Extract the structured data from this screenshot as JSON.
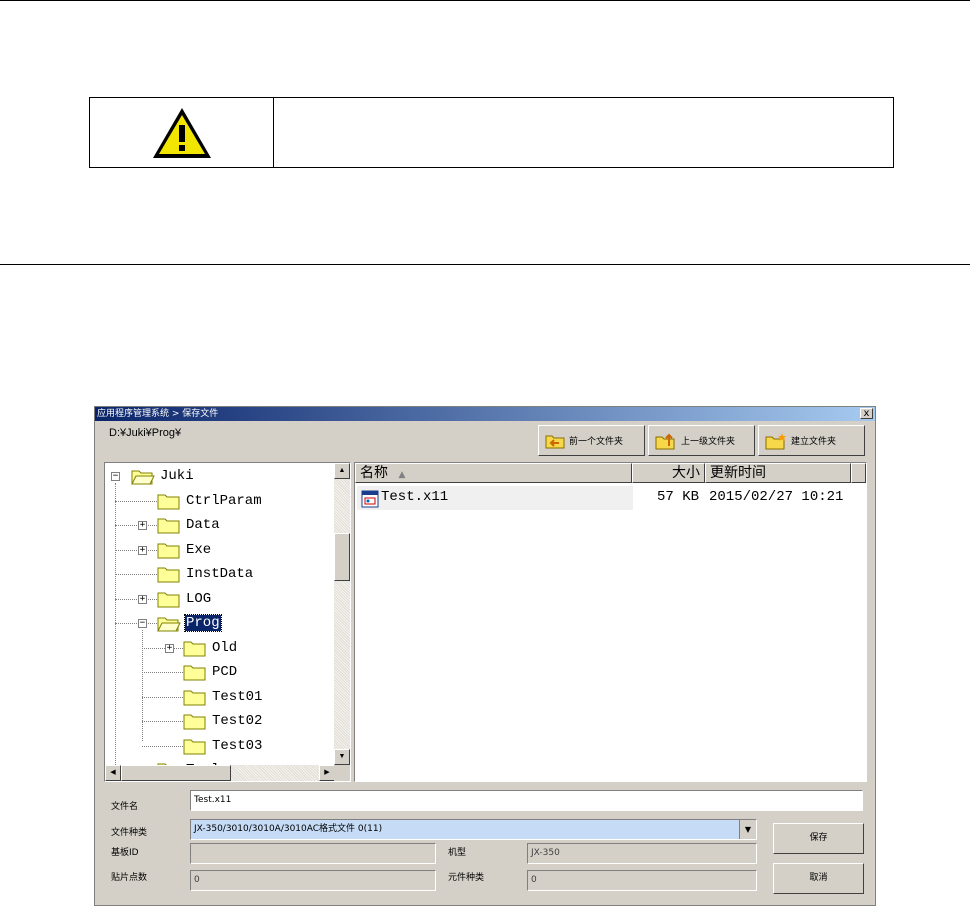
{
  "dialog": {
    "title": "应用程序管理系统 > 保存文件",
    "close_glyph": "x",
    "current_path": "D:¥Juki¥Prog¥",
    "toolbar": {
      "back_label": "前一个文件夹",
      "up_label": "上一级文件夹",
      "new_folder_label": "建立文件夹"
    },
    "tree": {
      "nodes": [
        {
          "label": "Juki",
          "expander": "−"
        },
        {
          "label": "CtrlParam"
        },
        {
          "label": "Data",
          "expander": "+"
        },
        {
          "label": "Exe",
          "expander": "+"
        },
        {
          "label": "InstData"
        },
        {
          "label": "LOG",
          "expander": "+"
        },
        {
          "label": "Prog",
          "expander": "−",
          "selected": true
        },
        {
          "label": "Old",
          "expander": "+"
        },
        {
          "label": "PCD"
        },
        {
          "label": "Test01"
        },
        {
          "label": "Test02"
        },
        {
          "label": "Test03"
        },
        {
          "label": "Tools",
          "expander": "+"
        }
      ]
    },
    "file_list": {
      "columns": [
        "名称",
        "大小",
        "更新时间"
      ],
      "files": [
        {
          "name": "Test.x11",
          "size": "57 KB",
          "modified": "2015/02/27 10:21"
        }
      ]
    },
    "form": {
      "filename_label": "文件名",
      "filename_value": "Test.x11",
      "filetype_label": "文件种类",
      "filetype_value": "JX-350/3010/3010A/3010AC格式文件 0(11)",
      "board_id_label": "基板ID",
      "board_id_value": "",
      "model_label": "机型",
      "model_value": "JX-350",
      "placement_count_label": "贴片点数",
      "placement_count_value": "0",
      "component_types_label": "元件种类",
      "component_types_value": "0",
      "save_label": "保存",
      "cancel_label": "取消"
    }
  },
  "colors": {
    "title_gradient_start": "#0a246a",
    "title_gradient_end": "#a6caf0",
    "dialog_face": "#d4d0c8",
    "selection": "#0a246a",
    "filetype_bg": "#c6dcf6",
    "folder_yellow": "#ffff99"
  }
}
